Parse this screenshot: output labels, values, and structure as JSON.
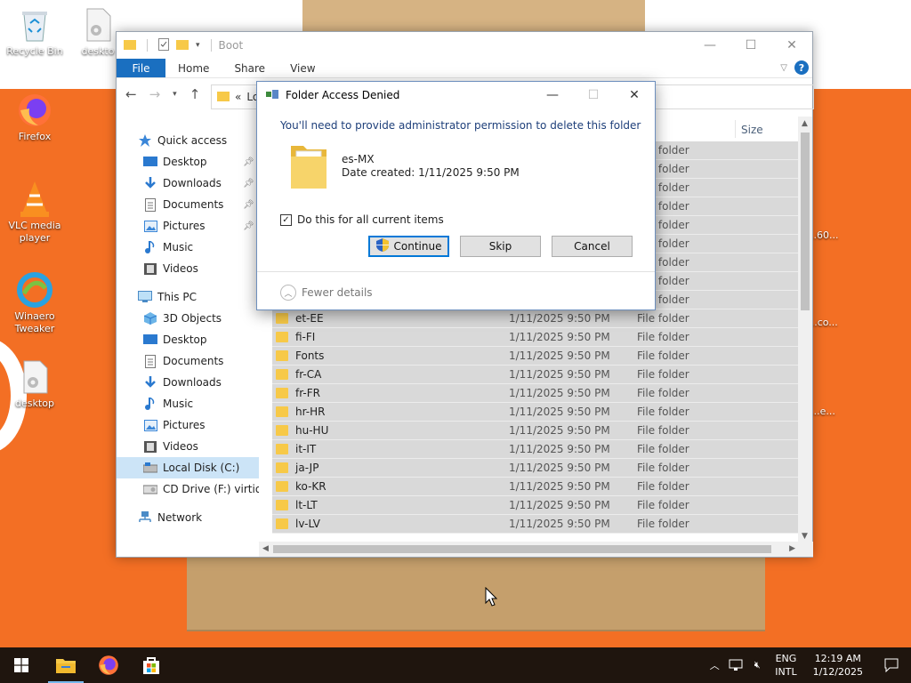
{
  "desktop": {
    "icons": [
      {
        "label": "Recycle Bin"
      },
      {
        "label": "deskto"
      },
      {
        "label": "Firefox"
      },
      {
        "label": "VLC media player"
      },
      {
        "label": "Winaero Tweaker"
      },
      {
        "label": "desktop"
      }
    ],
    "peek_labels": [
      "...60...",
      "...co...",
      "...e..."
    ]
  },
  "explorer": {
    "title": "Boot",
    "tabs": [
      "File",
      "Home",
      "Share",
      "View"
    ],
    "address": "Lo",
    "breadcrumb_prefix": "«",
    "sidebar": [
      {
        "label": "Quick access",
        "icon": "star-icon",
        "level": 0
      },
      {
        "label": "Desktop",
        "icon": "desktop-icon",
        "level": 1,
        "pinned": true
      },
      {
        "label": "Downloads",
        "icon": "download-icon",
        "level": 1,
        "pinned": true
      },
      {
        "label": "Documents",
        "icon": "documents-icon",
        "level": 1,
        "pinned": true
      },
      {
        "label": "Pictures",
        "icon": "pictures-icon",
        "level": 1,
        "pinned": true
      },
      {
        "label": "Music",
        "icon": "music-icon",
        "level": 1
      },
      {
        "label": "Videos",
        "icon": "videos-icon",
        "level": 1
      },
      {
        "label": "This PC",
        "icon": "computer-icon",
        "level": 0
      },
      {
        "label": "3D Objects",
        "icon": "cube-icon",
        "level": 1
      },
      {
        "label": "Desktop",
        "icon": "desktop-icon",
        "level": 1
      },
      {
        "label": "Documents",
        "icon": "documents-icon",
        "level": 1
      },
      {
        "label": "Downloads",
        "icon": "download-icon",
        "level": 1
      },
      {
        "label": "Music",
        "icon": "music-icon",
        "level": 1
      },
      {
        "label": "Pictures",
        "icon": "pictures-icon",
        "level": 1
      },
      {
        "label": "Videos",
        "icon": "videos-icon",
        "level": 1
      },
      {
        "label": "Local Disk (C:)",
        "icon": "drive-icon",
        "level": 1,
        "selected": true
      },
      {
        "label": "CD Drive (F:) virtio-",
        "icon": "cd-drive-icon",
        "level": 1
      },
      {
        "label": "Network",
        "icon": "network-icon",
        "level": 0
      }
    ],
    "columns": {
      "size": "Size"
    },
    "hidden_rows": [
      {
        "type": "File folder"
      },
      {
        "type": "File folder"
      },
      {
        "type": "File folder"
      },
      {
        "type": "File folder"
      },
      {
        "type": "File folder"
      },
      {
        "type": "File folder"
      },
      {
        "type": "File folder"
      },
      {
        "type": "File folder"
      },
      {
        "type": "File folder"
      }
    ],
    "rows": [
      {
        "name": "et-EE",
        "date": "1/11/2025 9:50 PM",
        "type": "File folder"
      },
      {
        "name": "fi-FI",
        "date": "1/11/2025 9:50 PM",
        "type": "File folder"
      },
      {
        "name": "Fonts",
        "date": "1/11/2025 9:50 PM",
        "type": "File folder"
      },
      {
        "name": "fr-CA",
        "date": "1/11/2025 9:50 PM",
        "type": "File folder"
      },
      {
        "name": "fr-FR",
        "date": "1/11/2025 9:50 PM",
        "type": "File folder"
      },
      {
        "name": "hr-HR",
        "date": "1/11/2025 9:50 PM",
        "type": "File folder"
      },
      {
        "name": "hu-HU",
        "date": "1/11/2025 9:50 PM",
        "type": "File folder"
      },
      {
        "name": "it-IT",
        "date": "1/11/2025 9:50 PM",
        "type": "File folder"
      },
      {
        "name": "ja-JP",
        "date": "1/11/2025 9:50 PM",
        "type": "File folder"
      },
      {
        "name": "ko-KR",
        "date": "1/11/2025 9:50 PM",
        "type": "File folder"
      },
      {
        "name": "lt-LT",
        "date": "1/11/2025 9:50 PM",
        "type": "File folder"
      },
      {
        "name": "lv-LV",
        "date": "1/11/2025 9:50 PM",
        "type": "File folder"
      }
    ]
  },
  "dialog": {
    "title": "Folder Access Denied",
    "message": "You'll need to provide administrator permission to delete this folder",
    "folder_name": "es-MX",
    "date_created": "Date created: 1/11/2025 9:50 PM",
    "checkbox_label": "Do this for all current items",
    "checkbox_checked": true,
    "continue_label": "Continue",
    "skip_label": "Skip",
    "cancel_label": "Cancel",
    "fewer_details": "Fewer details"
  },
  "taskbar": {
    "lang_line1": "ENG",
    "lang_line2": "INTL",
    "time": "12:19 AM",
    "date": "1/12/2025"
  },
  "colors": {
    "desktop_bg": "#f36f24",
    "accent": "#0078d7",
    "file_tab": "#1a6fc0",
    "taskbar": "#1f150e"
  }
}
